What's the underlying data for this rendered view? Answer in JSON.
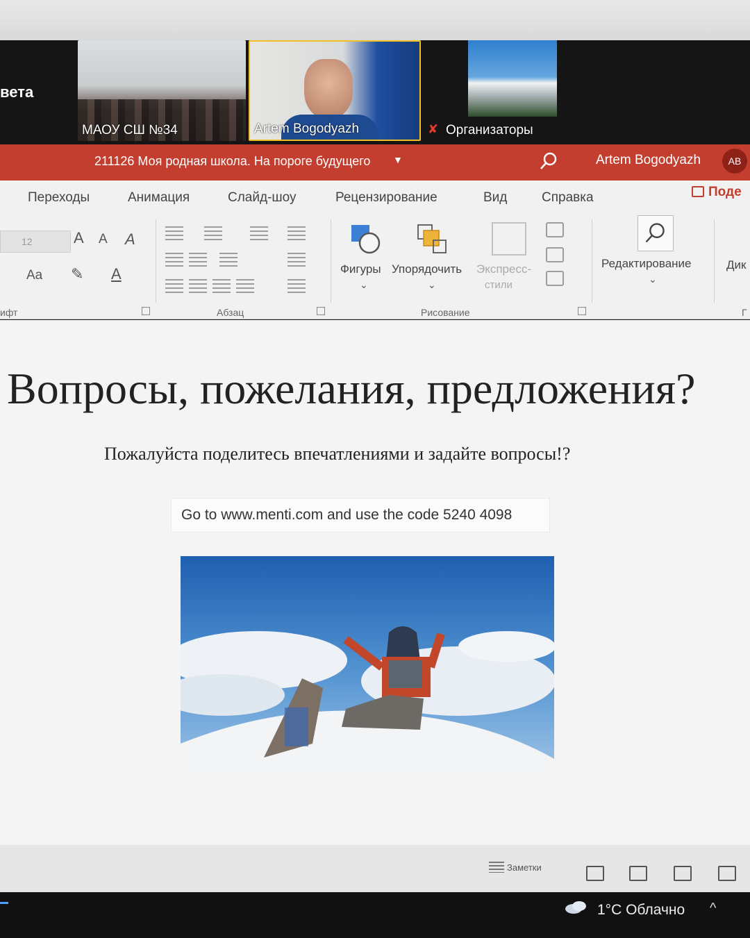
{
  "conference": {
    "side_title": "вета",
    "participants": [
      {
        "name": "МАОУ СШ №34"
      },
      {
        "name": "Artem Bogodyazh"
      },
      {
        "name": "Организаторы"
      }
    ]
  },
  "titlebar": {
    "doc_title": "211126 Моя родная школа. На пороге будущего",
    "user_name": "Artem Bogodyazh",
    "avatar_initials": "AB",
    "accent_color": "#c43e2f"
  },
  "ribbon": {
    "tabs": [
      "Переходы",
      "Анимация",
      "Слайд-шоу",
      "Рецензирование",
      "Вид",
      "Справка"
    ],
    "share_label": "Поде",
    "font_group": {
      "label": "ифт",
      "size_value": "12"
    },
    "paragraph_group": {
      "label": "Абзац"
    },
    "drawing_group": {
      "label": "Рисование",
      "shapes_label": "Фигуры",
      "arrange_label": "Упорядочить",
      "quick_styles_line1": "Экспресс-",
      "quick_styles_line2": "стили"
    },
    "editing_label": "Редактирование",
    "dictate_label": "Дик",
    "next_group_label": "Г"
  },
  "slide": {
    "title": "Вопросы, пожелания, предложения?",
    "subtitle": "Пожалуйста поделитесь впечатлениями и задайте вопросы!?",
    "code_text": "Go to www.menti.com and use the code 5240 4098"
  },
  "status_bar": {
    "notes_label": "Заметки"
  },
  "taskbar": {
    "weather": "1°C  Облачно"
  }
}
